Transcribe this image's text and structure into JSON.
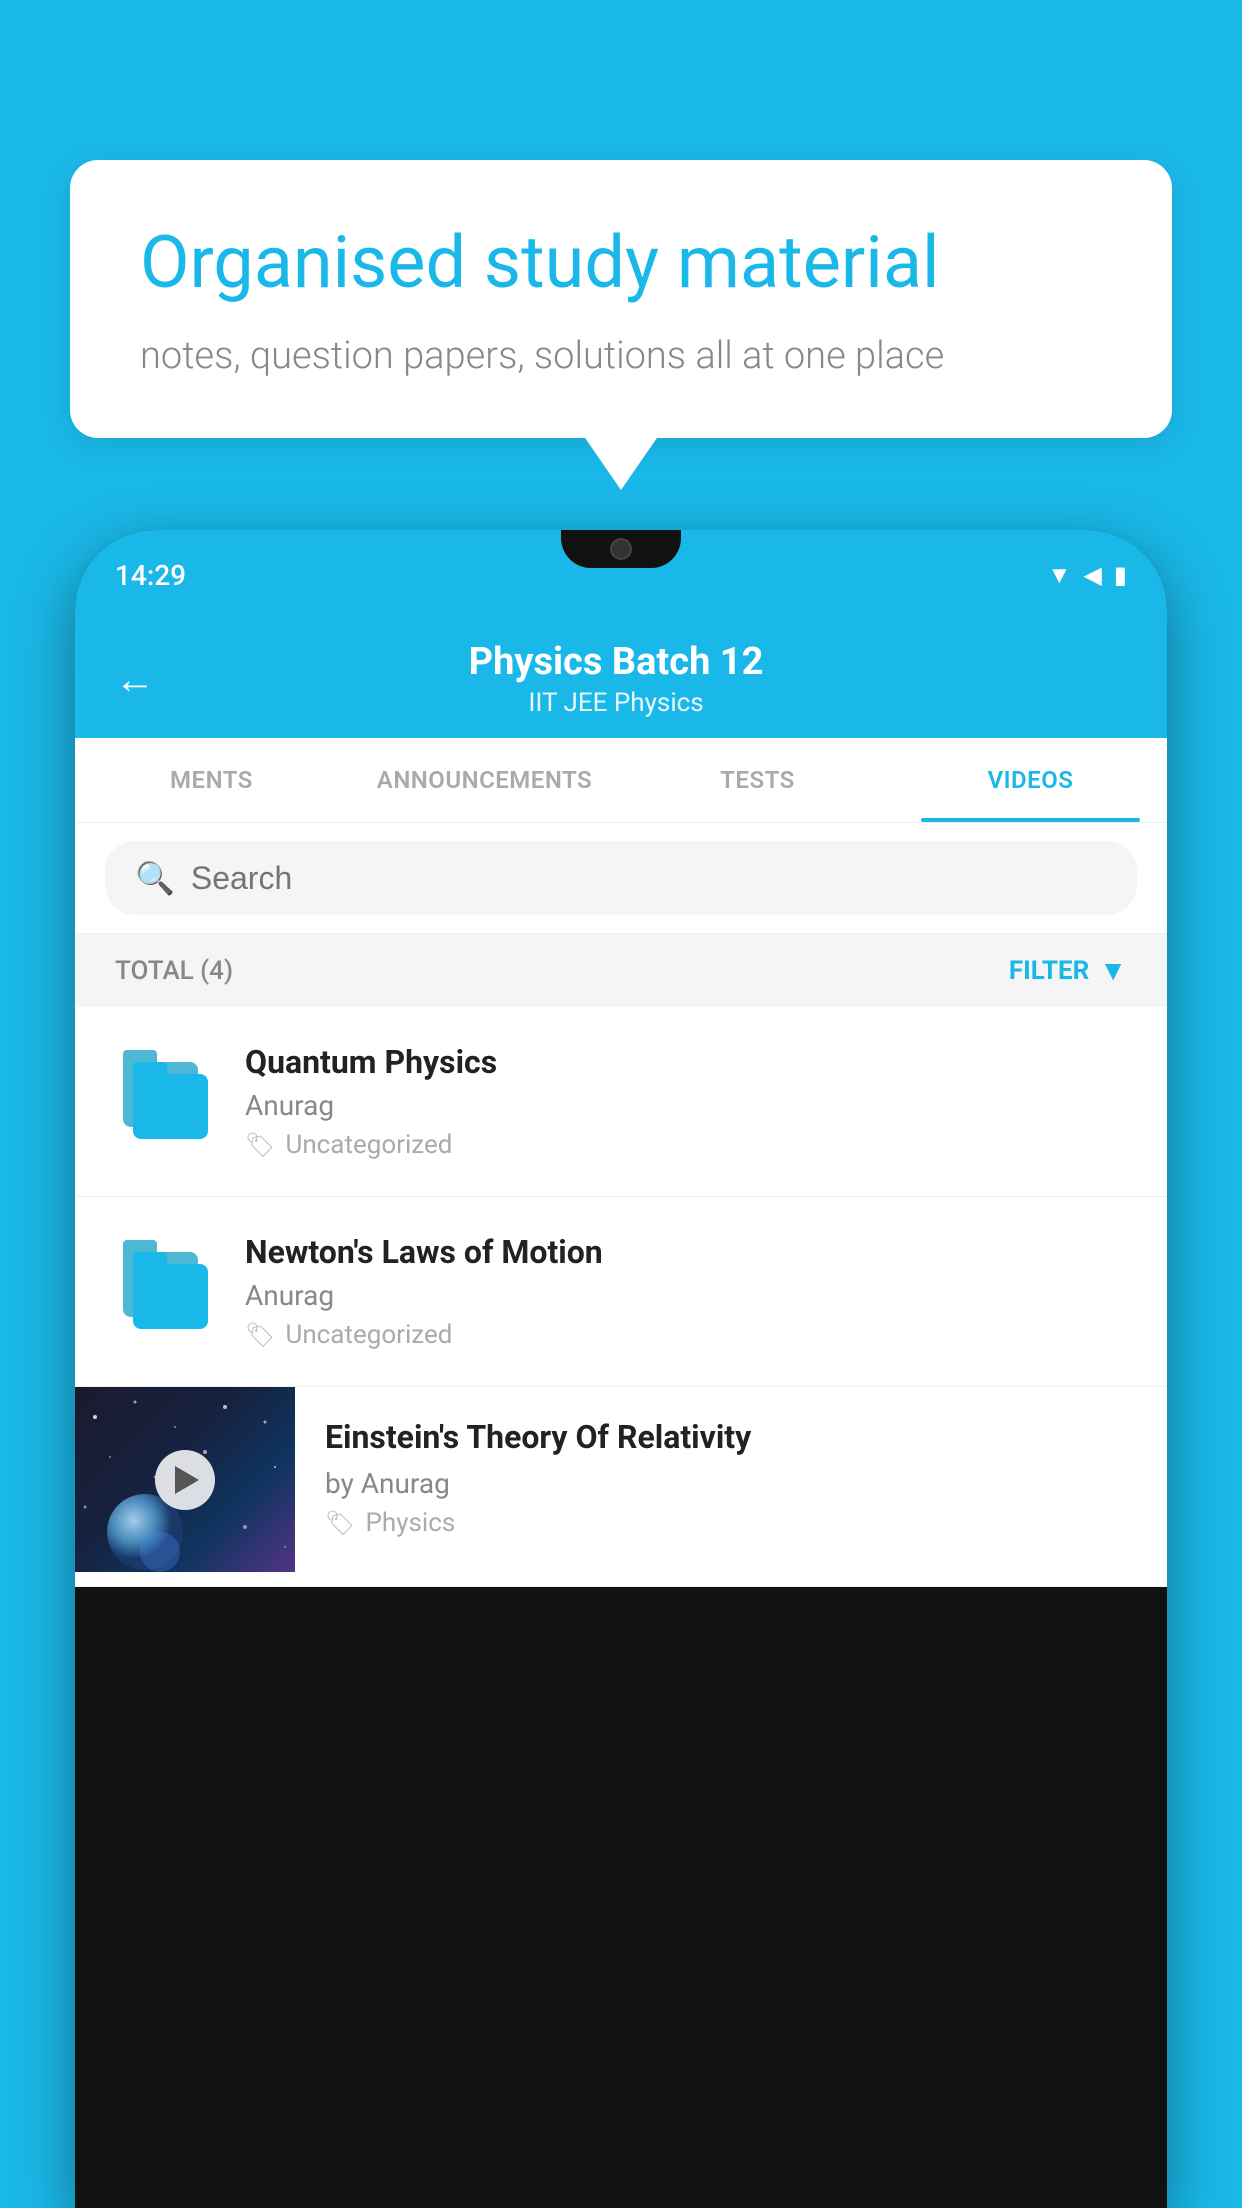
{
  "background_color": "#1ab8e8",
  "bubble": {
    "heading": "Organised study material",
    "subtext": "notes, question papers, solutions all at one place"
  },
  "phone": {
    "status_time": "14:29",
    "header": {
      "title": "Physics Batch 12",
      "subtitle": "IIT JEE   Physics",
      "back_label": "←"
    },
    "tabs": [
      {
        "label": "MENTS",
        "active": false
      },
      {
        "label": "ANNOUNCEMENTS",
        "active": false
      },
      {
        "label": "TESTS",
        "active": false
      },
      {
        "label": "VIDEOS",
        "active": true
      }
    ],
    "search": {
      "placeholder": "Search"
    },
    "filter": {
      "total_label": "TOTAL (4)",
      "filter_label": "FILTER"
    },
    "videos": [
      {
        "id": 1,
        "title": "Quantum Physics",
        "author": "Anurag",
        "tag": "Uncategorized",
        "type": "folder"
      },
      {
        "id": 2,
        "title": "Newton's Laws of Motion",
        "author": "Anurag",
        "tag": "Uncategorized",
        "type": "folder"
      },
      {
        "id": 3,
        "title": "Einstein's Theory Of Relativity",
        "author": "by Anurag",
        "tag": "Physics",
        "type": "video"
      }
    ]
  }
}
